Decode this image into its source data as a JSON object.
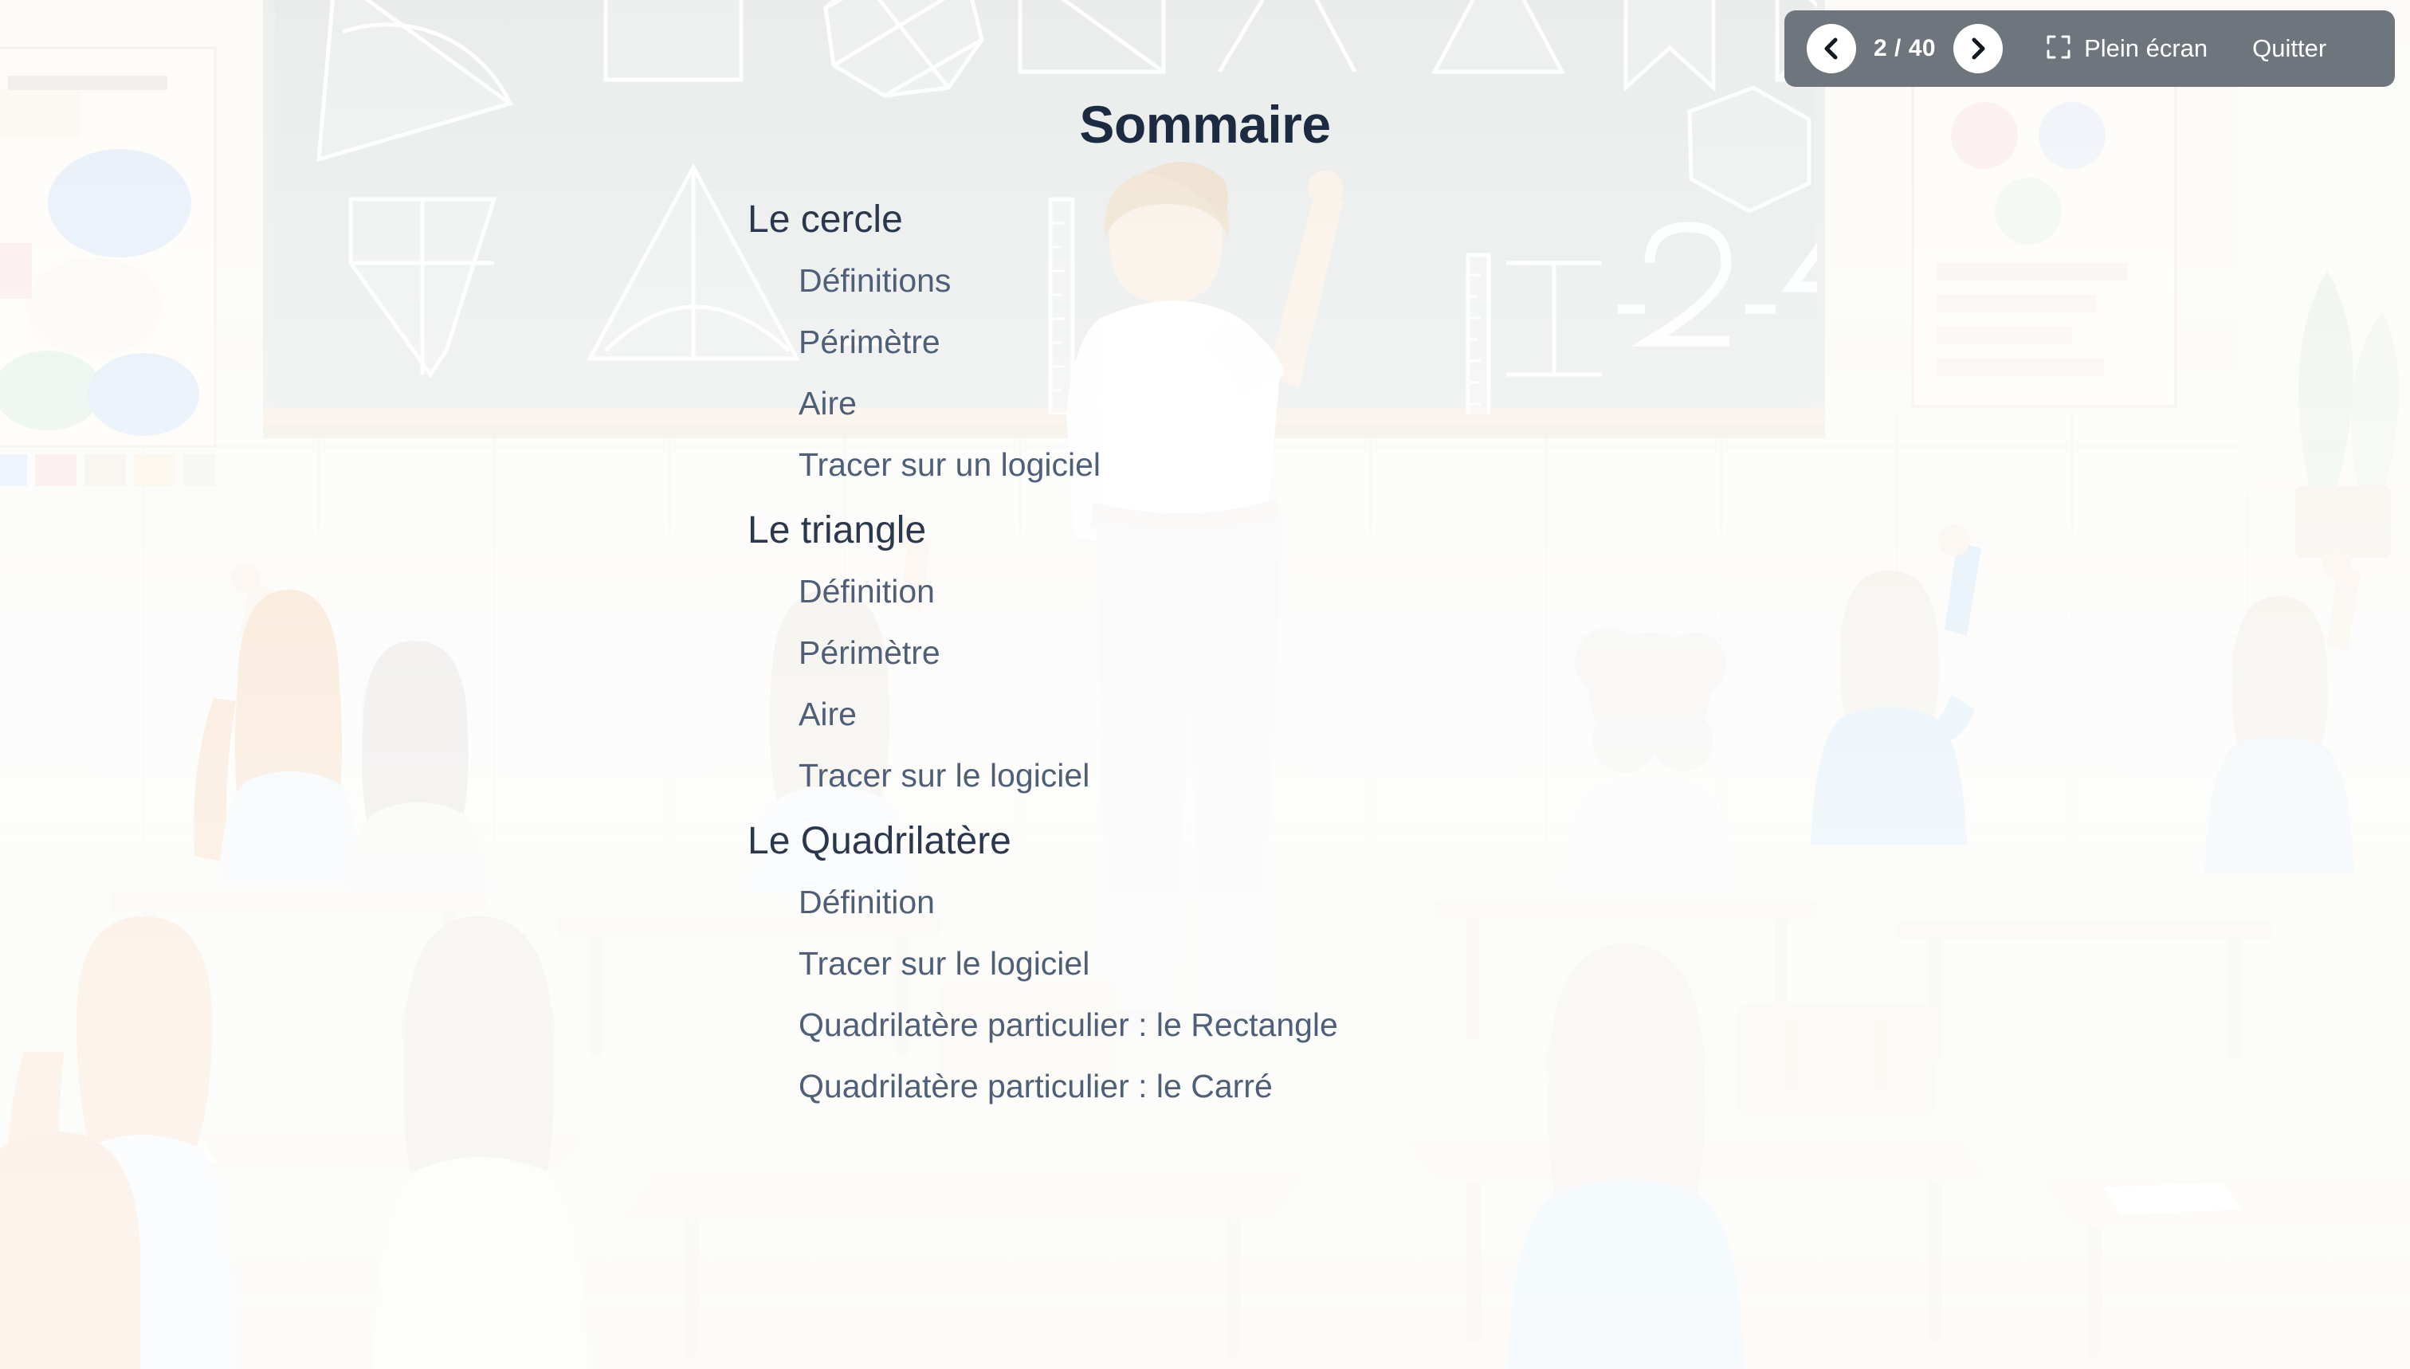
{
  "slide": {
    "title": "Sommaire",
    "sections": [
      {
        "heading": "Le cercle",
        "items": [
          "Définitions",
          "Périmètre",
          "Aire",
          "Tracer sur un logiciel"
        ]
      },
      {
        "heading": "Le triangle",
        "items": [
          "Définition",
          "Périmètre",
          "Aire",
          "Tracer sur le logiciel"
        ]
      },
      {
        "heading": "Le Quadrilatère",
        "items": [
          "Définition",
          "Tracer sur le logiciel",
          "Quadrilatère particulier : le Rectangle",
          "Quadrilatère particulier : le Carré"
        ]
      }
    ]
  },
  "toolbar": {
    "prev_icon": "chevron-left-icon",
    "next_icon": "chevron-right-icon",
    "page_counter": "2 / 40",
    "fullscreen_icon": "fullscreen-expand-icon",
    "fullscreen_label": "Plein écran",
    "exit_label": "Quitter",
    "background_color": "#6e757c",
    "text_color": "#ffffff"
  },
  "theme": {
    "title_color": "#1d2b42",
    "heading_color": "#2a374d",
    "item_color": "#4e5f77",
    "page_background": "#f2f3f1"
  },
  "background_scene": {
    "description": "classroom-illustration",
    "elements": [
      "blackboard",
      "teacher",
      "students",
      "desks",
      "geometric-shapes",
      "poster"
    ]
  }
}
